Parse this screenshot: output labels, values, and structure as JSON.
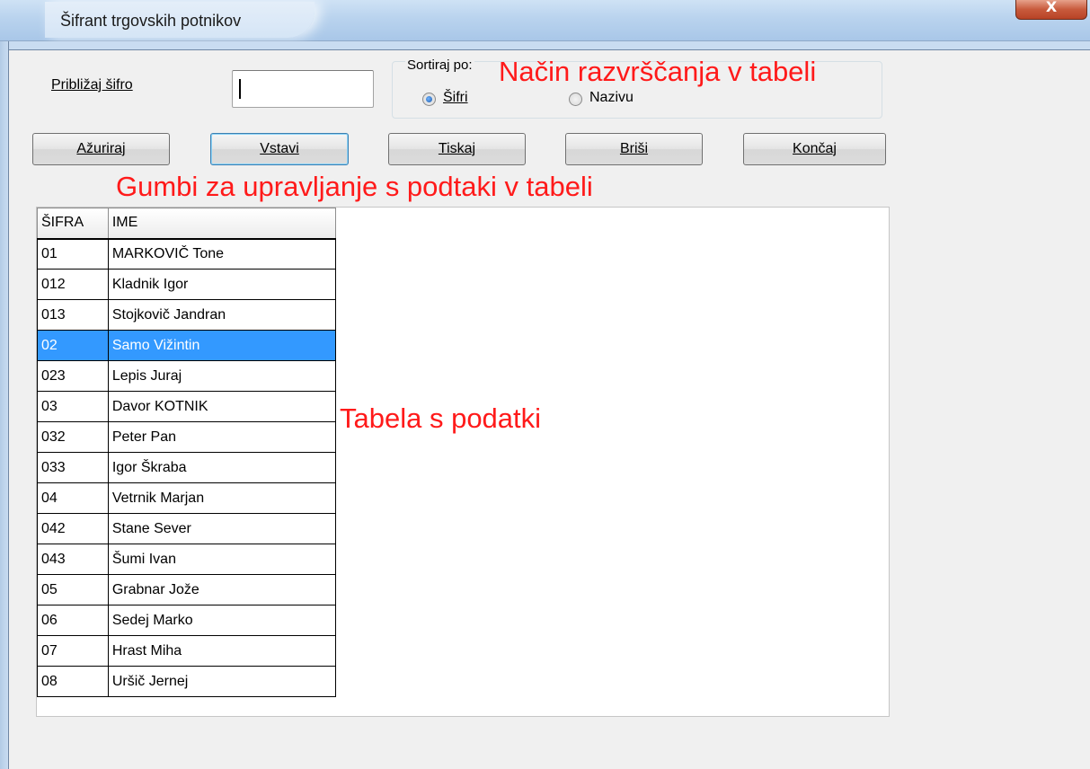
{
  "window": {
    "title": "Šifrant trgovskih potnikov",
    "close_glyph": "X"
  },
  "search": {
    "label": "Približaj šifro",
    "value": ""
  },
  "sort": {
    "legend": "Sortiraj po:",
    "options": [
      {
        "label": "Šifri",
        "checked": true
      },
      {
        "label": "Nazivu",
        "checked": false
      }
    ]
  },
  "buttons": [
    {
      "label": "Ažuriraj"
    },
    {
      "label": "Vstavi"
    },
    {
      "label": "Tiskaj"
    },
    {
      "label": "Briši"
    },
    {
      "label": "Končaj"
    }
  ],
  "annotations": {
    "sort": "Način razvrščanja v tabeli",
    "buttons": "Gumbi za upravljanje s podtaki v tabeli",
    "table": "Tabela s podatki"
  },
  "table": {
    "columns": [
      "ŠIFRA",
      "IME"
    ],
    "rows": [
      [
        "01",
        "MARKOVIČ Tone"
      ],
      [
        "012",
        "Kladnik Igor"
      ],
      [
        "013",
        "Stojkovič Jandran"
      ],
      [
        "02",
        "Samo Vižintin"
      ],
      [
        "023",
        "Lepis Juraj"
      ],
      [
        "03",
        "Davor KOTNIK"
      ],
      [
        "032",
        "Peter Pan"
      ],
      [
        "033",
        "Igor Škraba"
      ],
      [
        "04",
        "Vetrnik Marjan"
      ],
      [
        "042",
        "Stane Sever"
      ],
      [
        "043",
        "Šumi Ivan"
      ],
      [
        "05",
        "Grabnar Jože"
      ],
      [
        "06",
        "Sedej Marko"
      ],
      [
        "07",
        "Hrast Miha"
      ],
      [
        "08",
        "Uršič Jernej"
      ]
    ],
    "selected_row": "02"
  },
  "colors": {
    "selection": "#3399ff",
    "annotation": "#ff1a1a"
  }
}
